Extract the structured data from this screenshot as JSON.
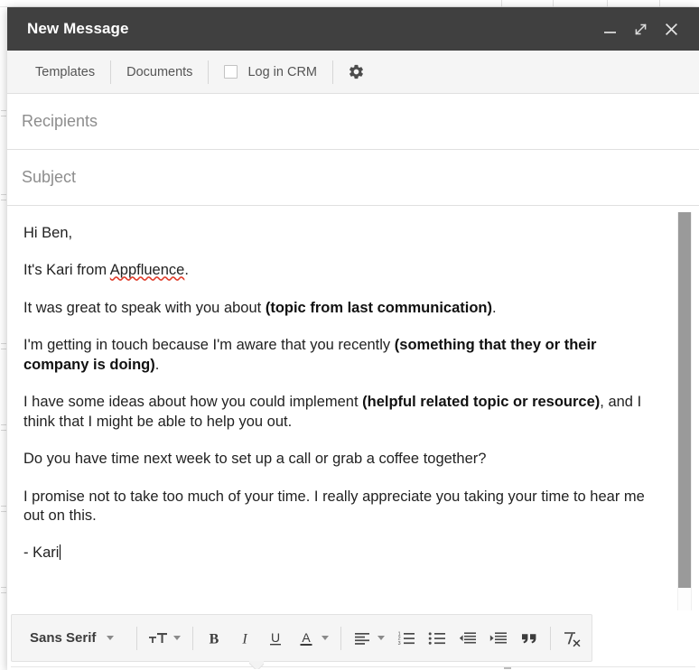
{
  "window": {
    "title": "New Message",
    "controls": [
      {
        "name": "minimize",
        "icon": "minimize-icon"
      },
      {
        "name": "expand",
        "icon": "expand-icon"
      },
      {
        "name": "close",
        "icon": "close-icon"
      }
    ],
    "header_bg": "#404040"
  },
  "plugin_bar": {
    "templates_label": "Templates",
    "documents_label": "Documents",
    "log_in_crm_label": "Log in CRM",
    "log_in_crm_checked": false,
    "settings_icon": "gear-icon"
  },
  "fields": {
    "recipients_placeholder": "Recipients",
    "recipients_value": "",
    "subject_placeholder": "Subject",
    "subject_value": ""
  },
  "body": {
    "p1": "Hi Ben,",
    "p2_pre": "It's Kari from ",
    "p2_misspelled": "Appfluence",
    "p2_post": ".",
    "p3_pre": "It was great to speak with you about ",
    "p3_bold": "(topic from last communication)",
    "p3_post": ".",
    "p4_pre": "I'm getting in touch because I'm aware that you recently ",
    "p4_bold": "(something that they or their company is doing)",
    "p4_post": ".",
    "p5_pre": "I have some ideas about how you could implement ",
    "p5_bold": "(helpful related topic or resource)",
    "p5_post": ", and I think that I might be able to help you out.",
    "p6": "Do you have time next week to set up a call or grab a coffee together?",
    "p7": "I promise not to take too much of your time. I really appreciate you taking your time to hear me out on this.",
    "p8": "- Kari"
  },
  "format_bar": {
    "font_family_value": "Sans Serif",
    "buttons": [
      {
        "name": "font-family-dropdown",
        "label": "Sans Serif"
      },
      {
        "name": "font-size-dropdown",
        "icon": "font-size-icon"
      },
      {
        "name": "bold-button",
        "icon": "bold-icon",
        "label": "B"
      },
      {
        "name": "italic-button",
        "icon": "italic-icon",
        "label": "I"
      },
      {
        "name": "underline-button",
        "icon": "underline-icon",
        "label": "U"
      },
      {
        "name": "text-color-dropdown",
        "icon": "text-color-icon",
        "label": "A"
      },
      {
        "name": "align-dropdown",
        "icon": "align-left-icon"
      },
      {
        "name": "numbered-list-button",
        "icon": "numbered-list-icon"
      },
      {
        "name": "bulleted-list-button",
        "icon": "bulleted-list-icon"
      },
      {
        "name": "outdent-button",
        "icon": "outdent-icon"
      },
      {
        "name": "indent-button",
        "icon": "indent-icon"
      },
      {
        "name": "quote-button",
        "icon": "blockquote-icon"
      },
      {
        "name": "remove-formatting-button",
        "icon": "remove-formatting-icon"
      }
    ]
  },
  "scrollbar": {
    "thumb_color": "#9a9a9a",
    "track_color": "#fdfdfd"
  }
}
